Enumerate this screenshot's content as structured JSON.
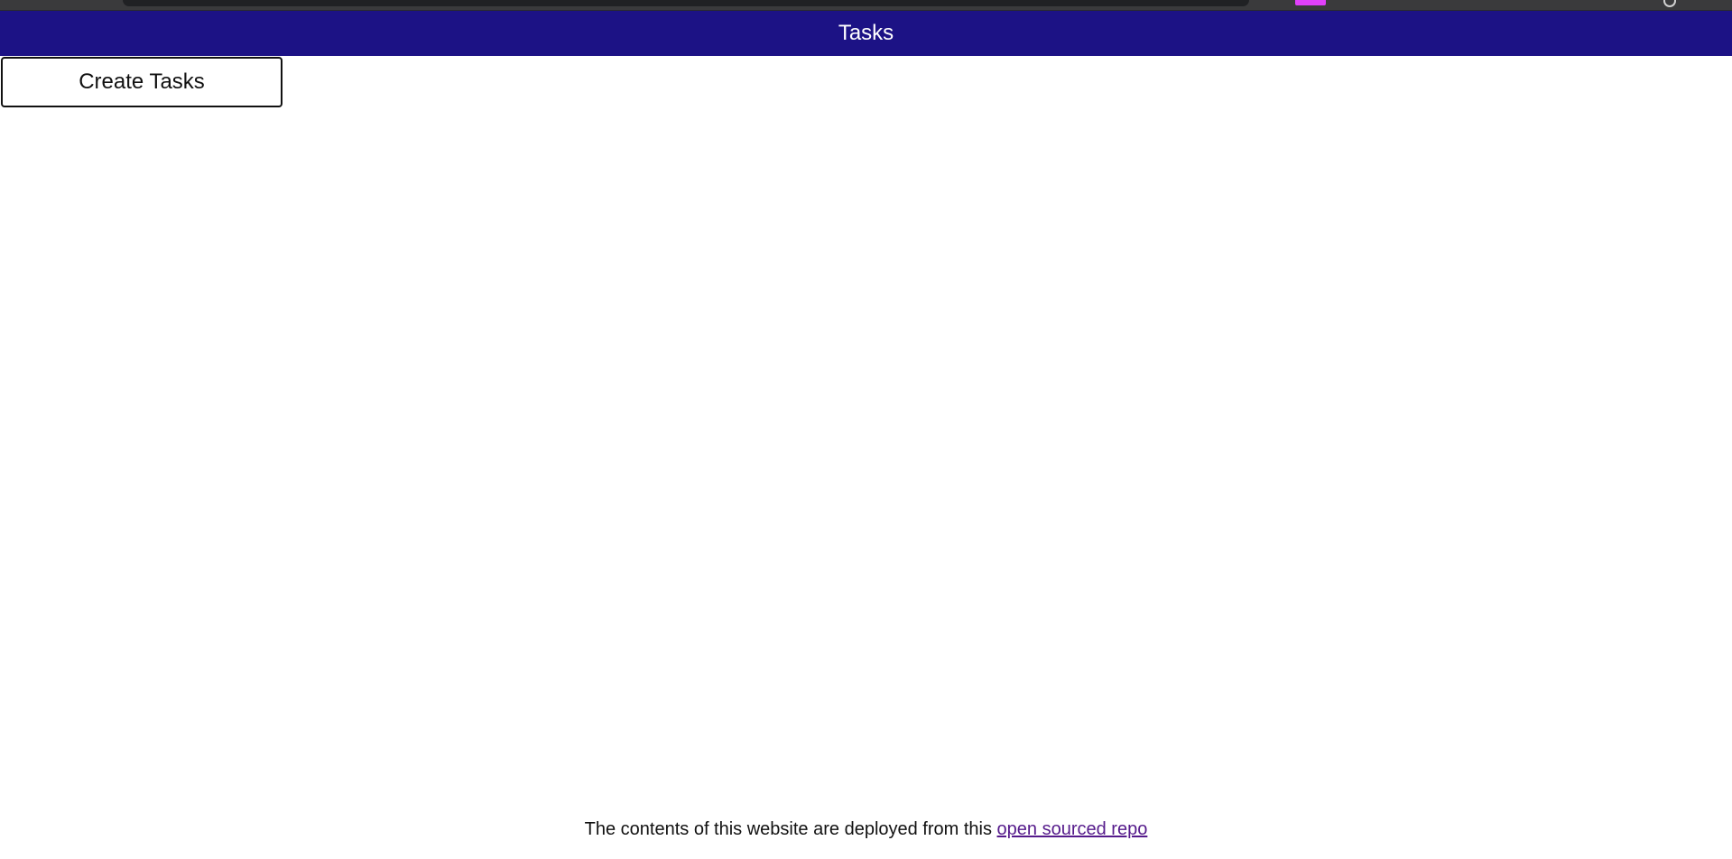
{
  "header": {
    "title": "Tasks",
    "background_color": "#1c1285"
  },
  "browser_chrome": {
    "extension_badge_color": "#e040fb"
  },
  "main": {
    "create_button_label": "Create Tasks"
  },
  "footer": {
    "text": "The contents of this website are deployed from this",
    "link_label": "open sourced repo",
    "link_color": "#551a8b"
  }
}
